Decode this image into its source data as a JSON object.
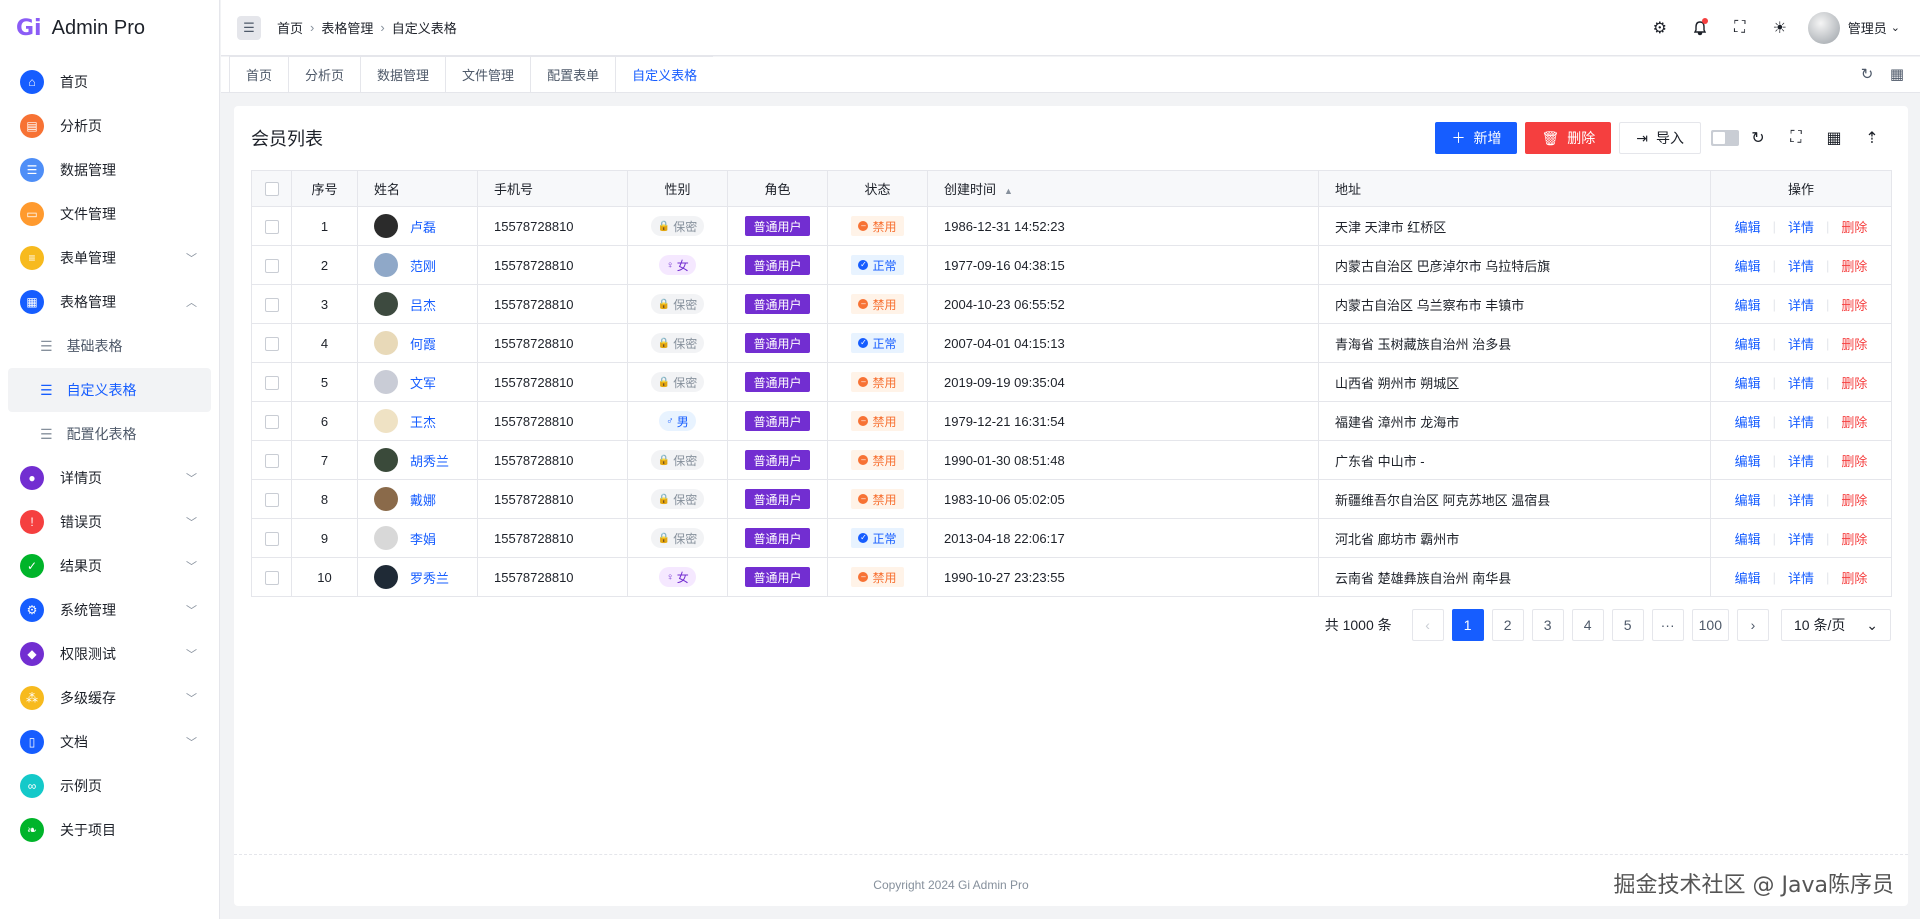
{
  "app": {
    "logo_mark": "Gi",
    "title": "Admin Pro"
  },
  "sidebar": {
    "items": [
      {
        "label": "首页",
        "icon": "home-icon",
        "color": "#165dff",
        "glyph": "⌂"
      },
      {
        "label": "分析页",
        "icon": "analytics-icon",
        "color": "#f77234",
        "glyph": "▤"
      },
      {
        "label": "数据管理",
        "icon": "database-icon",
        "color": "#4e8ef7",
        "glyph": "☰"
      },
      {
        "label": "文件管理",
        "icon": "folder-icon",
        "color": "#ff9a2e",
        "glyph": "▭"
      },
      {
        "label": "表单管理",
        "icon": "form-icon",
        "color": "#f7ba1e",
        "glyph": "≡"
      },
      {
        "label": "表格管理",
        "icon": "table-icon",
        "color": "#165dff",
        "glyph": "▦"
      }
    ],
    "sub_items": [
      {
        "label": "基础表格"
      },
      {
        "label": "自定义表格"
      },
      {
        "label": "配置化表格"
      }
    ],
    "items_after": [
      {
        "label": "详情页",
        "icon": "detail-icon",
        "color": "#722ed1",
        "glyph": "●"
      },
      {
        "label": "错误页",
        "icon": "error-icon",
        "color": "#f53f3f",
        "glyph": "!"
      },
      {
        "label": "结果页",
        "icon": "result-icon",
        "color": "#00b42a",
        "glyph": "✓"
      },
      {
        "label": "系统管理",
        "icon": "settings-icon",
        "color": "#165dff",
        "glyph": "⚙"
      },
      {
        "label": "权限测试",
        "icon": "shield-icon",
        "color": "#722ed1",
        "glyph": "◆"
      },
      {
        "label": "多级缓存",
        "icon": "cache-icon",
        "color": "#f7ba1e",
        "glyph": "⁂"
      },
      {
        "label": "文档",
        "icon": "doc-icon",
        "color": "#165dff",
        "glyph": "▯"
      },
      {
        "label": "示例页",
        "icon": "example-icon",
        "color": "#14c9c9",
        "glyph": "∞"
      },
      {
        "label": "关于项目",
        "icon": "leaf-icon",
        "color": "#00b42a",
        "glyph": "❧"
      }
    ]
  },
  "header": {
    "breadcrumb": [
      "首页",
      "表格管理",
      "自定义表格"
    ],
    "user_name": "管理员"
  },
  "tabs": [
    "首页",
    "分析页",
    "数据管理",
    "文件管理",
    "配置表单",
    "自定义表格"
  ],
  "card": {
    "title": "会员列表",
    "add_label": "新增",
    "delete_label": "删除",
    "import_label": "导入"
  },
  "table": {
    "headers": {
      "index": "序号",
      "name": "姓名",
      "phone": "手机号",
      "gender": "性别",
      "role": "角色",
      "status": "状态",
      "created": "创建时间",
      "address": "地址",
      "ops": "操作"
    },
    "rows": [
      {
        "index": "1",
        "name": "卢磊",
        "phone": "15578728810",
        "gender": "保密",
        "gender_type": "secret",
        "role": "普通用户",
        "status": "禁用",
        "status_type": "disabled",
        "created": "1986-12-31 14:52:23",
        "address": "天津 天津市 红桥区",
        "avatar_color": "#2b2b2b"
      },
      {
        "index": "2",
        "name": "范刚",
        "phone": "15578728810",
        "gender": "女",
        "gender_type": "female",
        "role": "普通用户",
        "status": "正常",
        "status_type": "normal",
        "created": "1977-09-16 04:38:15",
        "address": "内蒙古自治区 巴彦淖尔市 乌拉特后旗",
        "avatar_color": "#8fa8c8"
      },
      {
        "index": "3",
        "name": "吕杰",
        "phone": "15578728810",
        "gender": "保密",
        "gender_type": "secret",
        "role": "普通用户",
        "status": "禁用",
        "status_type": "disabled",
        "created": "2004-10-23 06:55:52",
        "address": "内蒙古自治区 乌兰察布市 丰镇市",
        "avatar_color": "#3d4a3f"
      },
      {
        "index": "4",
        "name": "何霞",
        "phone": "15578728810",
        "gender": "保密",
        "gender_type": "secret",
        "role": "普通用户",
        "status": "正常",
        "status_type": "normal",
        "created": "2007-04-01 04:15:13",
        "address": "青海省 玉树藏族自治州 治多县",
        "avatar_color": "#e8d9b8"
      },
      {
        "index": "5",
        "name": "文军",
        "phone": "15578728810",
        "gender": "保密",
        "gender_type": "secret",
        "role": "普通用户",
        "status": "禁用",
        "status_type": "disabled",
        "created": "2019-09-19 09:35:04",
        "address": "山西省 朔州市 朔城区",
        "avatar_color": "#c9ccd6"
      },
      {
        "index": "6",
        "name": "王杰",
        "phone": "15578728810",
        "gender": "男",
        "gender_type": "male",
        "role": "普通用户",
        "status": "禁用",
        "status_type": "disabled",
        "created": "1979-12-21 16:31:54",
        "address": "福建省 漳州市 龙海市",
        "avatar_color": "#efe2c4"
      },
      {
        "index": "7",
        "name": "胡秀兰",
        "phone": "15578728810",
        "gender": "保密",
        "gender_type": "secret",
        "role": "普通用户",
        "status": "禁用",
        "status_type": "disabled",
        "created": "1990-01-30 08:51:48",
        "address": "广东省 中山市 -",
        "avatar_color": "#3a4a3a"
      },
      {
        "index": "8",
        "name": "戴娜",
        "phone": "15578728810",
        "gender": "保密",
        "gender_type": "secret",
        "role": "普通用户",
        "status": "禁用",
        "status_type": "disabled",
        "created": "1983-10-06 05:02:05",
        "address": "新疆维吾尔自治区 阿克苏地区 温宿县",
        "avatar_color": "#8a6a4a"
      },
      {
        "index": "9",
        "name": "李娟",
        "phone": "15578728810",
        "gender": "保密",
        "gender_type": "secret",
        "role": "普通用户",
        "status": "正常",
        "status_type": "normal",
        "created": "2013-04-18 22:06:17",
        "address": "河北省 廊坊市 霸州市",
        "avatar_color": "#d8d8d8"
      },
      {
        "index": "10",
        "name": "罗秀兰",
        "phone": "15578728810",
        "gender": "女",
        "gender_type": "female",
        "role": "普通用户",
        "status": "禁用",
        "status_type": "disabled",
        "created": "1990-10-27 23:23:55",
        "address": "云南省 楚雄彝族自治州 南华县",
        "avatar_color": "#1f2a36"
      }
    ],
    "ops": {
      "edit": "编辑",
      "detail": "详情",
      "delete": "删除"
    }
  },
  "pagination": {
    "total": "共 1000 条",
    "pages": [
      "1",
      "2",
      "3",
      "4",
      "5"
    ],
    "ellipsis": "···",
    "last": "100",
    "current": "1",
    "page_size": "10 条/页"
  },
  "footer": {
    "copyright": "Copyright 2024 Gi Admin Pro"
  },
  "watermark": "掘金技术社区 @ Java陈序员"
}
